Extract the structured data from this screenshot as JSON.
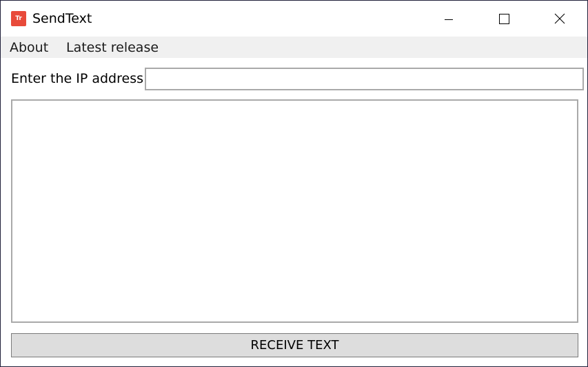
{
  "window": {
    "title": "SendText",
    "icon_text": "Tr",
    "icon_name": "sendtext-app-icon",
    "accent_color": "#e84a3a"
  },
  "window_controls": {
    "minimize_icon": "minimize-icon",
    "maximize_icon": "maximize-icon",
    "close_icon": "close-icon"
  },
  "menu": {
    "items": [
      {
        "label": "About"
      },
      {
        "label": "Latest release"
      }
    ]
  },
  "form": {
    "ip_label": "Enter the IP address:",
    "ip_value": "",
    "ip_placeholder": "",
    "text_value": ""
  },
  "actions": {
    "receive_label": "RECEIVE TEXT"
  }
}
